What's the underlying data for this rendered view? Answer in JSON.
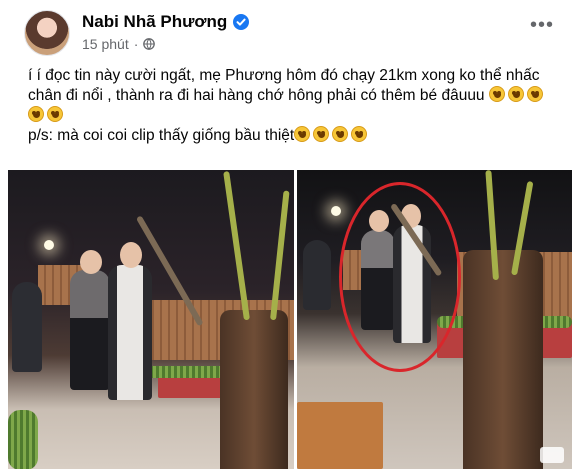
{
  "post": {
    "author": "Nabi Nhã Phương",
    "time": "15 phút",
    "separator": "·",
    "more_label": "•••",
    "text_line1": "í í đọc tin này cười ngất,  mẹ Phương hôm đó chạy 21km xong ko thể nhấc chân đi nổi , thành ra đi hai hàng chớ  hông phải có thêm bé đâuuu",
    "text_line2": "p/s: mà coi coi clip thấy giống bầu thiệt",
    "emoji_name": "laughing-face",
    "emoji_count_line1": 5,
    "emoji_count_line2": 4
  },
  "icons": {
    "verified": "verified-badge-icon",
    "privacy": "globe-icon",
    "more": "more-options-icon"
  },
  "colors": {
    "verified_blue": "#1877f2",
    "meta_gray": "#65676b",
    "circle_red": "#d9262b"
  }
}
